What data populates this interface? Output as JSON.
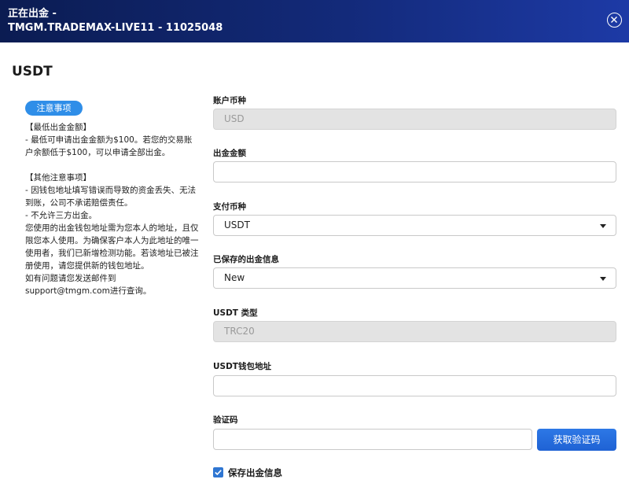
{
  "header": {
    "title_line1": "正在出金 -",
    "title_line2": "TMGM.TRADEMAX-LIVE11 - 11025048",
    "close_icon": "close-circle-icon"
  },
  "section_title": "USDT",
  "notice": {
    "badge": "注意事项",
    "min_title": "【最低出金金额】",
    "min_text": "- 最低可申请出金金额为$100。若您的交易账户余额低于$100，可以申请全部出金。",
    "other_title": "【其他注意事项】",
    "other_line1": "- 因钱包地址填写错误而导致的资金丢失、无法到账，公司不承诺赔偿责任。",
    "other_line2": "- 不允许三方出金。",
    "other_line3": "您使用的出金钱包地址需为您本人的地址，且仅限您本人使用。为确保客户本人为此地址的唯一使用者，我们已新增检测功能。若该地址已被注册使用，请您提供新的钱包地址。",
    "other_line4": "如有问题请您发送邮件到support@tmgm.com进行查询。"
  },
  "form": {
    "account_currency": {
      "label": "账户币种",
      "value": "USD"
    },
    "withdraw_amount": {
      "label": "出金金额",
      "value": ""
    },
    "payment_currency": {
      "label": "支付币种",
      "value": "USDT"
    },
    "saved_info": {
      "label": "已保存的出金信息",
      "value": "New"
    },
    "usdt_type": {
      "label": "USDT 类型",
      "value": "TRC20"
    },
    "wallet_address": {
      "label": "USDT钱包地址",
      "value": ""
    },
    "verification_code": {
      "label": "验证码",
      "value": "",
      "button": "获取验证码"
    },
    "save_info": {
      "label": "保存出金信息",
      "checked": true
    }
  },
  "colors": {
    "header_start": "#0b1c52",
    "header_end": "#1d3aa6",
    "accent": "#2f8ee8",
    "button": "#1f62d4",
    "disabled_bg": "#e3e3e3"
  }
}
